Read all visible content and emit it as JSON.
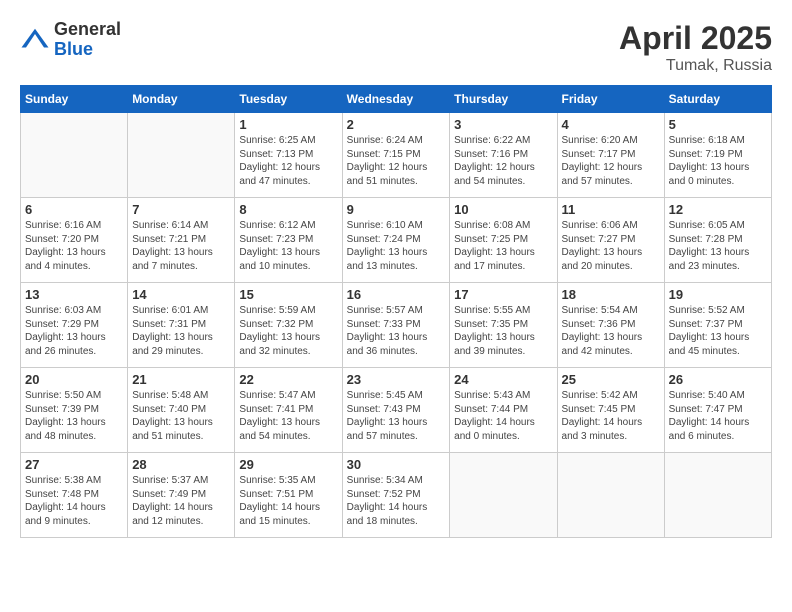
{
  "logo": {
    "general": "General",
    "blue": "Blue"
  },
  "title": "April 2025",
  "location": "Tumak, Russia",
  "days_header": [
    "Sunday",
    "Monday",
    "Tuesday",
    "Wednesday",
    "Thursday",
    "Friday",
    "Saturday"
  ],
  "weeks": [
    [
      {
        "day": "",
        "info": ""
      },
      {
        "day": "",
        "info": ""
      },
      {
        "day": "1",
        "info": "Sunrise: 6:25 AM\nSunset: 7:13 PM\nDaylight: 12 hours and 47 minutes."
      },
      {
        "day": "2",
        "info": "Sunrise: 6:24 AM\nSunset: 7:15 PM\nDaylight: 12 hours and 51 minutes."
      },
      {
        "day": "3",
        "info": "Sunrise: 6:22 AM\nSunset: 7:16 PM\nDaylight: 12 hours and 54 minutes."
      },
      {
        "day": "4",
        "info": "Sunrise: 6:20 AM\nSunset: 7:17 PM\nDaylight: 12 hours and 57 minutes."
      },
      {
        "day": "5",
        "info": "Sunrise: 6:18 AM\nSunset: 7:19 PM\nDaylight: 13 hours and 0 minutes."
      }
    ],
    [
      {
        "day": "6",
        "info": "Sunrise: 6:16 AM\nSunset: 7:20 PM\nDaylight: 13 hours and 4 minutes."
      },
      {
        "day": "7",
        "info": "Sunrise: 6:14 AM\nSunset: 7:21 PM\nDaylight: 13 hours and 7 minutes."
      },
      {
        "day": "8",
        "info": "Sunrise: 6:12 AM\nSunset: 7:23 PM\nDaylight: 13 hours and 10 minutes."
      },
      {
        "day": "9",
        "info": "Sunrise: 6:10 AM\nSunset: 7:24 PM\nDaylight: 13 hours and 13 minutes."
      },
      {
        "day": "10",
        "info": "Sunrise: 6:08 AM\nSunset: 7:25 PM\nDaylight: 13 hours and 17 minutes."
      },
      {
        "day": "11",
        "info": "Sunrise: 6:06 AM\nSunset: 7:27 PM\nDaylight: 13 hours and 20 minutes."
      },
      {
        "day": "12",
        "info": "Sunrise: 6:05 AM\nSunset: 7:28 PM\nDaylight: 13 hours and 23 minutes."
      }
    ],
    [
      {
        "day": "13",
        "info": "Sunrise: 6:03 AM\nSunset: 7:29 PM\nDaylight: 13 hours and 26 minutes."
      },
      {
        "day": "14",
        "info": "Sunrise: 6:01 AM\nSunset: 7:31 PM\nDaylight: 13 hours and 29 minutes."
      },
      {
        "day": "15",
        "info": "Sunrise: 5:59 AM\nSunset: 7:32 PM\nDaylight: 13 hours and 32 minutes."
      },
      {
        "day": "16",
        "info": "Sunrise: 5:57 AM\nSunset: 7:33 PM\nDaylight: 13 hours and 36 minutes."
      },
      {
        "day": "17",
        "info": "Sunrise: 5:55 AM\nSunset: 7:35 PM\nDaylight: 13 hours and 39 minutes."
      },
      {
        "day": "18",
        "info": "Sunrise: 5:54 AM\nSunset: 7:36 PM\nDaylight: 13 hours and 42 minutes."
      },
      {
        "day": "19",
        "info": "Sunrise: 5:52 AM\nSunset: 7:37 PM\nDaylight: 13 hours and 45 minutes."
      }
    ],
    [
      {
        "day": "20",
        "info": "Sunrise: 5:50 AM\nSunset: 7:39 PM\nDaylight: 13 hours and 48 minutes."
      },
      {
        "day": "21",
        "info": "Sunrise: 5:48 AM\nSunset: 7:40 PM\nDaylight: 13 hours and 51 minutes."
      },
      {
        "day": "22",
        "info": "Sunrise: 5:47 AM\nSunset: 7:41 PM\nDaylight: 13 hours and 54 minutes."
      },
      {
        "day": "23",
        "info": "Sunrise: 5:45 AM\nSunset: 7:43 PM\nDaylight: 13 hours and 57 minutes."
      },
      {
        "day": "24",
        "info": "Sunrise: 5:43 AM\nSunset: 7:44 PM\nDaylight: 14 hours and 0 minutes."
      },
      {
        "day": "25",
        "info": "Sunrise: 5:42 AM\nSunset: 7:45 PM\nDaylight: 14 hours and 3 minutes."
      },
      {
        "day": "26",
        "info": "Sunrise: 5:40 AM\nSunset: 7:47 PM\nDaylight: 14 hours and 6 minutes."
      }
    ],
    [
      {
        "day": "27",
        "info": "Sunrise: 5:38 AM\nSunset: 7:48 PM\nDaylight: 14 hours and 9 minutes."
      },
      {
        "day": "28",
        "info": "Sunrise: 5:37 AM\nSunset: 7:49 PM\nDaylight: 14 hours and 12 minutes."
      },
      {
        "day": "29",
        "info": "Sunrise: 5:35 AM\nSunset: 7:51 PM\nDaylight: 14 hours and 15 minutes."
      },
      {
        "day": "30",
        "info": "Sunrise: 5:34 AM\nSunset: 7:52 PM\nDaylight: 14 hours and 18 minutes."
      },
      {
        "day": "",
        "info": ""
      },
      {
        "day": "",
        "info": ""
      },
      {
        "day": "",
        "info": ""
      }
    ]
  ]
}
